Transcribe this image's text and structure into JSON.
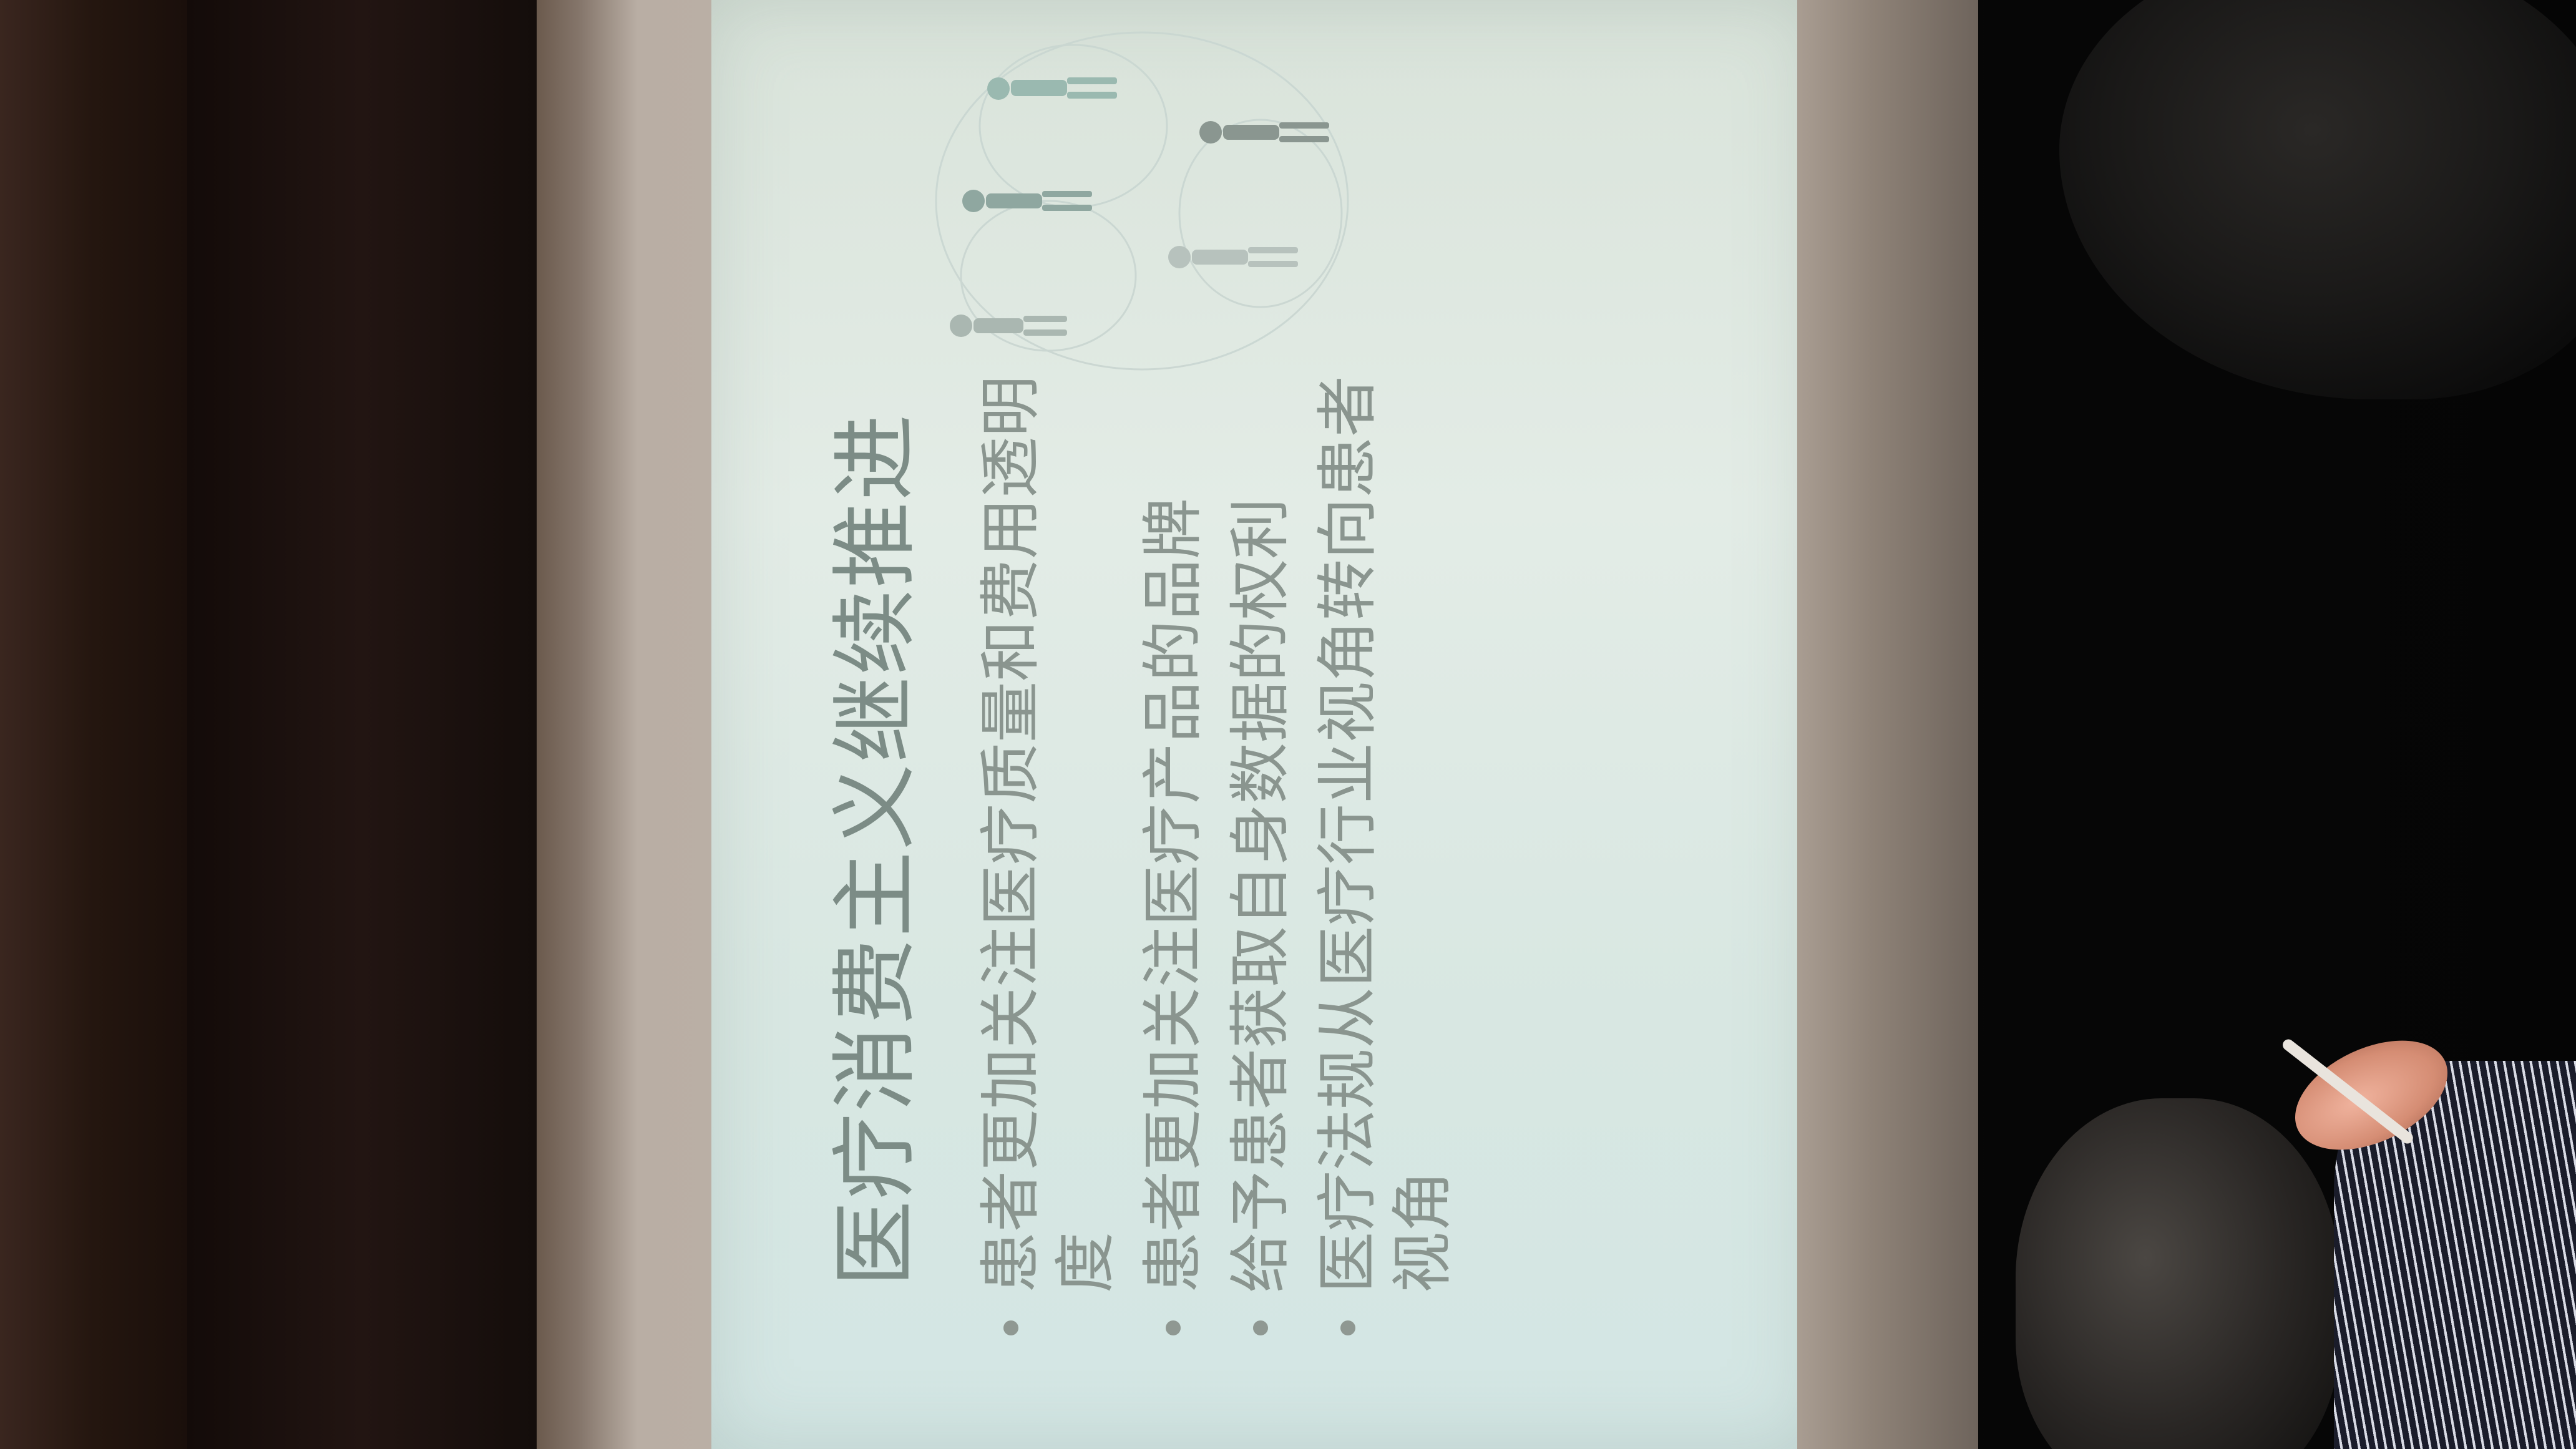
{
  "slide": {
    "title": "医疗消费主义继续推进",
    "bullets": [
      "患者更加关注医疗质量和费用透明度",
      "患者更加关注医疗产品的品牌",
      "给予患者获取自身数据的权利",
      "医疗法规从医疗行业视角转向患者视角"
    ]
  },
  "colors": {
    "slide_background": "#dfe9e3",
    "slide_text": "#8a958f",
    "title_text": "#7c8c86"
  },
  "illustration": {
    "icon": "people-walking-icon"
  }
}
